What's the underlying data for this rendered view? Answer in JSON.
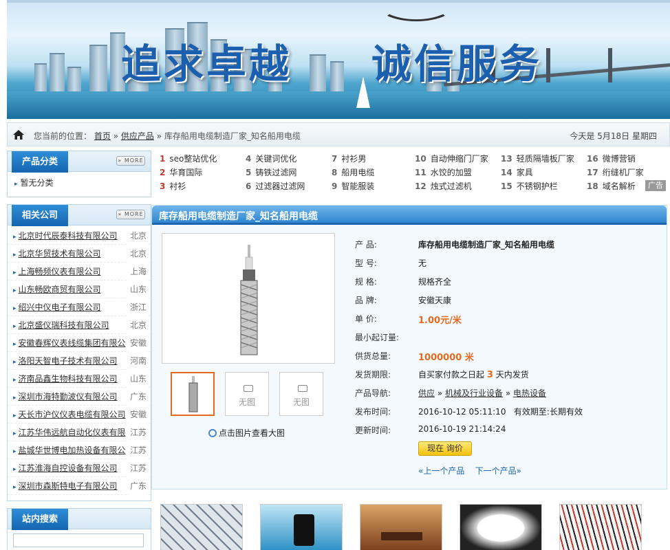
{
  "banner": {
    "slogan_left": "追求卓越",
    "slogan_right": "诚信服务"
  },
  "breadcrumb": {
    "prefix": "您当前的位置：",
    "home": "首页",
    "section": "供应产品",
    "separator": "»",
    "current": "库存船用电缆制造厂家_知名船用电缆",
    "today": "今天是  5月18日 星期四"
  },
  "sidebar": {
    "categories_title": "产品分类",
    "more_label": "» MORE",
    "categories": [
      "暂无分类"
    ],
    "companies_title": "相关公司",
    "companies": [
      {
        "name": "北京时代辰泰科技有限公司",
        "region": "北京"
      },
      {
        "name": "北京华贸技术有限公司",
        "region": "北京"
      },
      {
        "name": "上海畅频仪表有限公司",
        "region": "上海"
      },
      {
        "name": "山东畅欧商贸有限公司",
        "region": "山东"
      },
      {
        "name": "绍兴中仪电子有限公司",
        "region": "浙江"
      },
      {
        "name": "北京盛仪瑞科技有限公司",
        "region": "北京"
      },
      {
        "name": "安徽春辉仪表线缆集团有限公",
        "region": "安徽"
      },
      {
        "name": "洛阳天智电子技术有限公司",
        "region": "河南"
      },
      {
        "name": "济南品鑫生物科技有限公司",
        "region": "山东"
      },
      {
        "name": "深圳市海特勤波仪有限公司",
        "region": "广东"
      },
      {
        "name": "天长市沪仪仪表电缆有限公司",
        "region": "安徽"
      },
      {
        "name": "江苏华伟远航自动化仪表有限",
        "region": "江苏"
      },
      {
        "name": "盐城华世博电加热设备有限公",
        "region": "江苏"
      },
      {
        "name": "江苏淮海自控设备有限公司",
        "region": "江苏"
      },
      {
        "name": "深圳市森斯特电子有限公司",
        "region": "广东"
      }
    ],
    "search_title": "站内搜索"
  },
  "keywords": [
    {
      "n": "1",
      "t": "seo整站优化"
    },
    {
      "n": "2",
      "t": "华育国际"
    },
    {
      "n": "3",
      "t": "衬衫"
    },
    {
      "n": "4",
      "t": "关键词优化"
    },
    {
      "n": "5",
      "t": "铸铁过滤网"
    },
    {
      "n": "6",
      "t": "过滤器过滤网"
    },
    {
      "n": "7",
      "t": "衬衫男"
    },
    {
      "n": "8",
      "t": "船用电缆"
    },
    {
      "n": "9",
      "t": "智能服装"
    },
    {
      "n": "10",
      "t": "自动伸缩门厂家"
    },
    {
      "n": "11",
      "t": "水饺的加盟"
    },
    {
      "n": "12",
      "t": "烛式过滤机"
    },
    {
      "n": "13",
      "t": "轻质隔墙板厂家"
    },
    {
      "n": "14",
      "t": "家具"
    },
    {
      "n": "15",
      "t": "不锈钢护栏"
    },
    {
      "n": "16",
      "t": "微博营销"
    },
    {
      "n": "17",
      "t": "绗缝机厂家"
    },
    {
      "n": "18",
      "t": "域名解析"
    }
  ],
  "ad_label": "广告",
  "product": {
    "title": "库存船用电缆制造厂家_知名船用电缆",
    "no_image": "无图",
    "zoom_hint": "点击图片查看大图",
    "fields": {
      "name_label": "产  品:",
      "name": "库存船用电缆制造厂家_知名船用电缆",
      "model_label": "型  号:",
      "model": "无",
      "spec_label": "规  格:",
      "spec": "规格齐全",
      "brand_label": "品  牌:",
      "brand": "安徽天康",
      "price_label": "单  价:",
      "price": "1.00元/米",
      "moq_label": "最小起订量:",
      "moq": "",
      "supply_label": "供货总量:",
      "supply": "1000000 米",
      "ship_label": "发货期限:",
      "ship_pre": "自买家付款之日起",
      "ship_days": "3",
      "ship_post": "天内发货",
      "nav_label": "产品导航:",
      "nav": [
        "供应",
        "机械及行业设备",
        "电热设备"
      ],
      "nav_sep": "»",
      "pub_label": "发布时间:",
      "pub": "2016-10-12 05:11:10",
      "valid_label": "有效期至:",
      "valid": "长期有效",
      "upd_label": "更新时间:",
      "upd": "2016-10-19 21:14:24"
    },
    "inquire": "现在 询价",
    "prev": "«上一个产品",
    "next": "下一个产品»"
  },
  "colors": {
    "accent_blue": "#1c65ae",
    "price_orange": "#e46a1f"
  }
}
